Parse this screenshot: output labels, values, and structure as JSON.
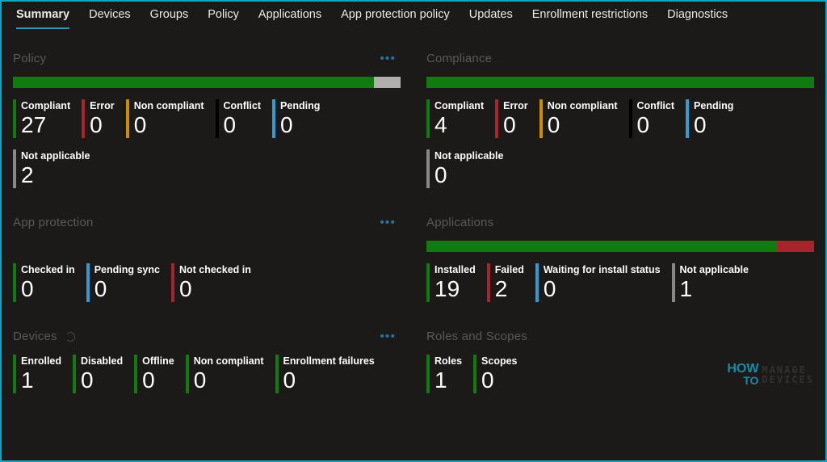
{
  "colors": {
    "green": "#107c10",
    "red": "#a4262c",
    "amber": "#ca8d03",
    "black": "#000000",
    "blue": "#2e9dd6",
    "gray": "#8a8886",
    "lightgray": "#b0afad"
  },
  "tabs": [
    {
      "label": "Summary",
      "active": true
    },
    {
      "label": "Devices",
      "active": false
    },
    {
      "label": "Groups",
      "active": false
    },
    {
      "label": "Policy",
      "active": false
    },
    {
      "label": "Applications",
      "active": false
    },
    {
      "label": "App protection policy",
      "active": false
    },
    {
      "label": "Updates",
      "active": false
    },
    {
      "label": "Enrollment restrictions",
      "active": false
    },
    {
      "label": "Diagnostics",
      "active": false
    }
  ],
  "cards": {
    "policy": {
      "title": "Policy",
      "bar": [
        {
          "color": "green",
          "weight": 27
        },
        {
          "color": "lightgray",
          "weight": 2
        }
      ],
      "stats": [
        {
          "label": "Compliant",
          "value": "27",
          "color": "green"
        },
        {
          "label": "Error",
          "value": "0",
          "color": "red"
        },
        {
          "label": "Non compliant",
          "value": "0",
          "color": "amber"
        },
        {
          "label": "Conflict",
          "value": "0",
          "color": "black"
        },
        {
          "label": "Pending",
          "value": "0",
          "color": "blue"
        },
        {
          "label": "Not applicable",
          "value": "2",
          "color": "gray"
        }
      ]
    },
    "compliance": {
      "title": "Compliance",
      "bar": [
        {
          "color": "green",
          "weight": 4
        }
      ],
      "stats": [
        {
          "label": "Compliant",
          "value": "4",
          "color": "green"
        },
        {
          "label": "Error",
          "value": "0",
          "color": "red"
        },
        {
          "label": "Non compliant",
          "value": "0",
          "color": "amber"
        },
        {
          "label": "Conflict",
          "value": "0",
          "color": "black"
        },
        {
          "label": "Pending",
          "value": "0",
          "color": "blue"
        },
        {
          "label": "Not applicable",
          "value": "0",
          "color": "gray"
        }
      ]
    },
    "appprotection": {
      "title": "App protection",
      "stats": [
        {
          "label": "Checked in",
          "value": "0",
          "color": "green"
        },
        {
          "label": "Pending sync",
          "value": "0",
          "color": "blue"
        },
        {
          "label": "Not checked in",
          "value": "0",
          "color": "red"
        }
      ]
    },
    "applications": {
      "title": "Applications",
      "bar": [
        {
          "color": "green",
          "weight": 19
        },
        {
          "color": "red",
          "weight": 2
        }
      ],
      "stats": [
        {
          "label": "Installed",
          "value": "19",
          "color": "green"
        },
        {
          "label": "Failed",
          "value": "2",
          "color": "red"
        },
        {
          "label": "Waiting for install status",
          "value": "0",
          "color": "blue"
        },
        {
          "label": "Not applicable",
          "value": "1",
          "color": "gray"
        }
      ]
    },
    "devices": {
      "title": "Devices",
      "stats": [
        {
          "label": "Enrolled",
          "value": "1",
          "color": "green"
        },
        {
          "label": "Disabled",
          "value": "0",
          "color": "green"
        },
        {
          "label": "Offline",
          "value": "0",
          "color": "green"
        },
        {
          "label": "Non compliant",
          "value": "0",
          "color": "green"
        },
        {
          "label": "Enrollment failures",
          "value": "0",
          "color": "green"
        }
      ]
    },
    "roles": {
      "title": "Roles and Scopes",
      "stats": [
        {
          "label": "Roles",
          "value": "1",
          "color": "green"
        },
        {
          "label": "Scopes",
          "value": "0",
          "color": "green"
        }
      ]
    }
  },
  "watermark": {
    "how": "HOW",
    "to": "TO",
    "line1": "MANAGE",
    "line2": "DEVICES"
  }
}
